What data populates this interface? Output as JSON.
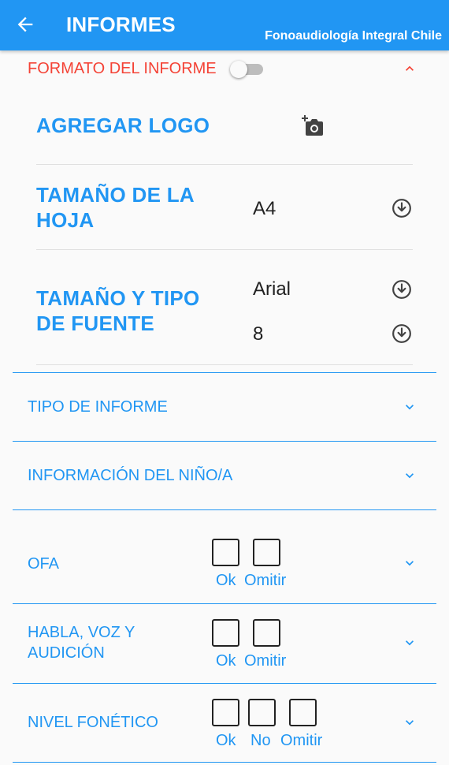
{
  "appbar": {
    "title": "INFORMES",
    "subtitle": "Fonoaudiología Integral Chile",
    "background": "#2196f3",
    "back_icon": "arrow-back-icon"
  },
  "format_section": {
    "title": "FORMATO DEL INFORME",
    "title_color": "#f44336",
    "toggle_on": false,
    "expanded": true,
    "add_logo": {
      "label": "AGREGAR LOGO",
      "icon": "add-photo-icon"
    },
    "page_size": {
      "label_line1": "TAMAÑO DE LA",
      "label_line2": "HOJA",
      "value": "A4",
      "icon": "download-circle-icon"
    },
    "font": {
      "label_line1": "TAMAÑO Y TIPO",
      "label_line2": "DE FUENTE",
      "family": "Arial",
      "size": "8",
      "icon": "download-circle-icon"
    }
  },
  "sections": {
    "tipo": {
      "label": "TIPO DE INFORME"
    },
    "info": {
      "label": "INFORMACIÓN DEL NIÑO/A"
    },
    "ofa": {
      "label": "OFA",
      "checks": [
        "Ok",
        "Omitir"
      ]
    },
    "habla": {
      "label_line1": "HABLA, VOZ Y",
      "label_line2": "AUDICIÓN",
      "checks": [
        "Ok",
        "Omitir"
      ]
    },
    "nivel": {
      "label": "NIVEL FONÉTICO",
      "checks": [
        "Ok",
        "No",
        "Omitir"
      ]
    }
  },
  "accent_color": "#2196f3"
}
